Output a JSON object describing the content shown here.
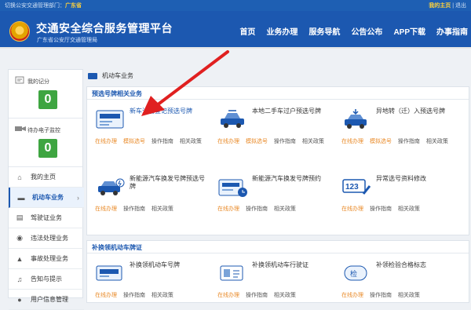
{
  "topbar": {
    "switch_text": "切换公安交通管理部门：",
    "region": "广东省",
    "home": "我的主页",
    "logout": "退出"
  },
  "header": {
    "title": "交通安全综合服务管理平台",
    "subtitle": "广东省公安厅交通管理局"
  },
  "nav": [
    "首页",
    "业务办理",
    "服务导航",
    "公告公布",
    "APP下载",
    "办事指南"
  ],
  "sidebar": {
    "score_label": "我的记分",
    "score_value": "0",
    "monitor_label": "待办电子监控",
    "monitor_value": "0",
    "menu": [
      "我的主页",
      "机动车业务",
      "驾驶证业务",
      "违法处理业务",
      "事故处理业务",
      "告知与提示",
      "用户信息管理"
    ]
  },
  "breadcrumb": "机动车业务",
  "section1": {
    "title": "预选号牌相关业务",
    "services": [
      {
        "name": "新车注册登记预选号牌",
        "links": [
          "在线办理",
          "模拟选号",
          "操作指南",
          "相关政策"
        ]
      },
      {
        "name": "本地二手车过户预选号牌",
        "links": [
          "在线办理",
          "模拟选号",
          "操作指南",
          "相关政策"
        ]
      },
      {
        "name": "异地转（迁）入预选号牌",
        "links": [
          "在线办理",
          "模拟选号",
          "操作指南",
          "相关政策"
        ]
      },
      {
        "name": "新能源汽车换发号牌预选号牌",
        "links": [
          "在线办理",
          "操作指南",
          "相关政策"
        ]
      },
      {
        "name": "新能源汽车换发号牌预约",
        "links": [
          "在线办理",
          "操作指南",
          "相关政策"
        ]
      },
      {
        "name": "异常选号资料修改",
        "links": [
          "在线办理",
          "操作指南",
          "相关政策"
        ]
      }
    ]
  },
  "section2": {
    "title": "补换领机动车牌证",
    "services": [
      {
        "name": "补换领机动车号牌",
        "links": [
          "在线办理",
          "操作指南",
          "相关政策"
        ]
      },
      {
        "name": "补换领机动车行驶证",
        "links": [
          "在线办理",
          "操作指南",
          "相关政策"
        ]
      },
      {
        "name": "补领检验合格标志",
        "links": [
          "在线办理",
          "操作指南",
          "相关政策"
        ]
      }
    ]
  },
  "colors": {
    "brand": "#1c58b0",
    "score_green": "#3ea541",
    "online_orange": "#e98b2a",
    "annotation_red": "#e02020"
  }
}
